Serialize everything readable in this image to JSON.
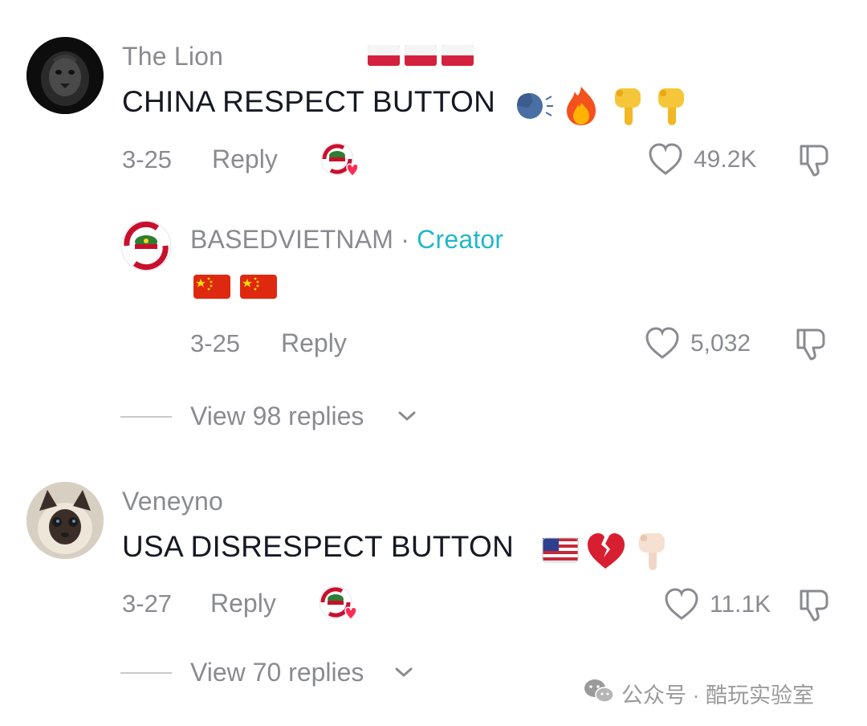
{
  "comments": [
    {
      "username": "The Lion",
      "text": "CHINA RESPECT BUTTON",
      "date": "3-25",
      "reply_label": "Reply",
      "likes": "49.2K",
      "username_emoji": "poland-flag-x3",
      "text_emoji": [
        "speaking-head",
        "fire",
        "point-down",
        "point-down"
      ]
    },
    {
      "username": "BASEDVIETNAM",
      "badge_separator": "·",
      "badge": "Creator",
      "text_emoji": [
        "china-flag",
        "china-flag"
      ],
      "date": "3-25",
      "reply_label": "Reply",
      "likes": "5,032"
    },
    {
      "username": "Veneyno",
      "text": "USA DISRESPECT BUTTON",
      "date": "3-27",
      "reply_label": "Reply",
      "likes": "11.1K",
      "text_emoji": [
        "usa-flag",
        "broken-heart",
        "point-down"
      ]
    }
  ],
  "view_replies": [
    {
      "label": "View 98 replies"
    },
    {
      "label": "View 70 replies"
    }
  ],
  "watermark": {
    "text": "公众号 · 酷玩实验室",
    "icon": "wechat-icon"
  },
  "colors": {
    "creator_accent": "#20b8c9",
    "muted_text": "#8a8b91",
    "primary_text": "#161823",
    "creator_liked_heart": "#ff2c55"
  }
}
